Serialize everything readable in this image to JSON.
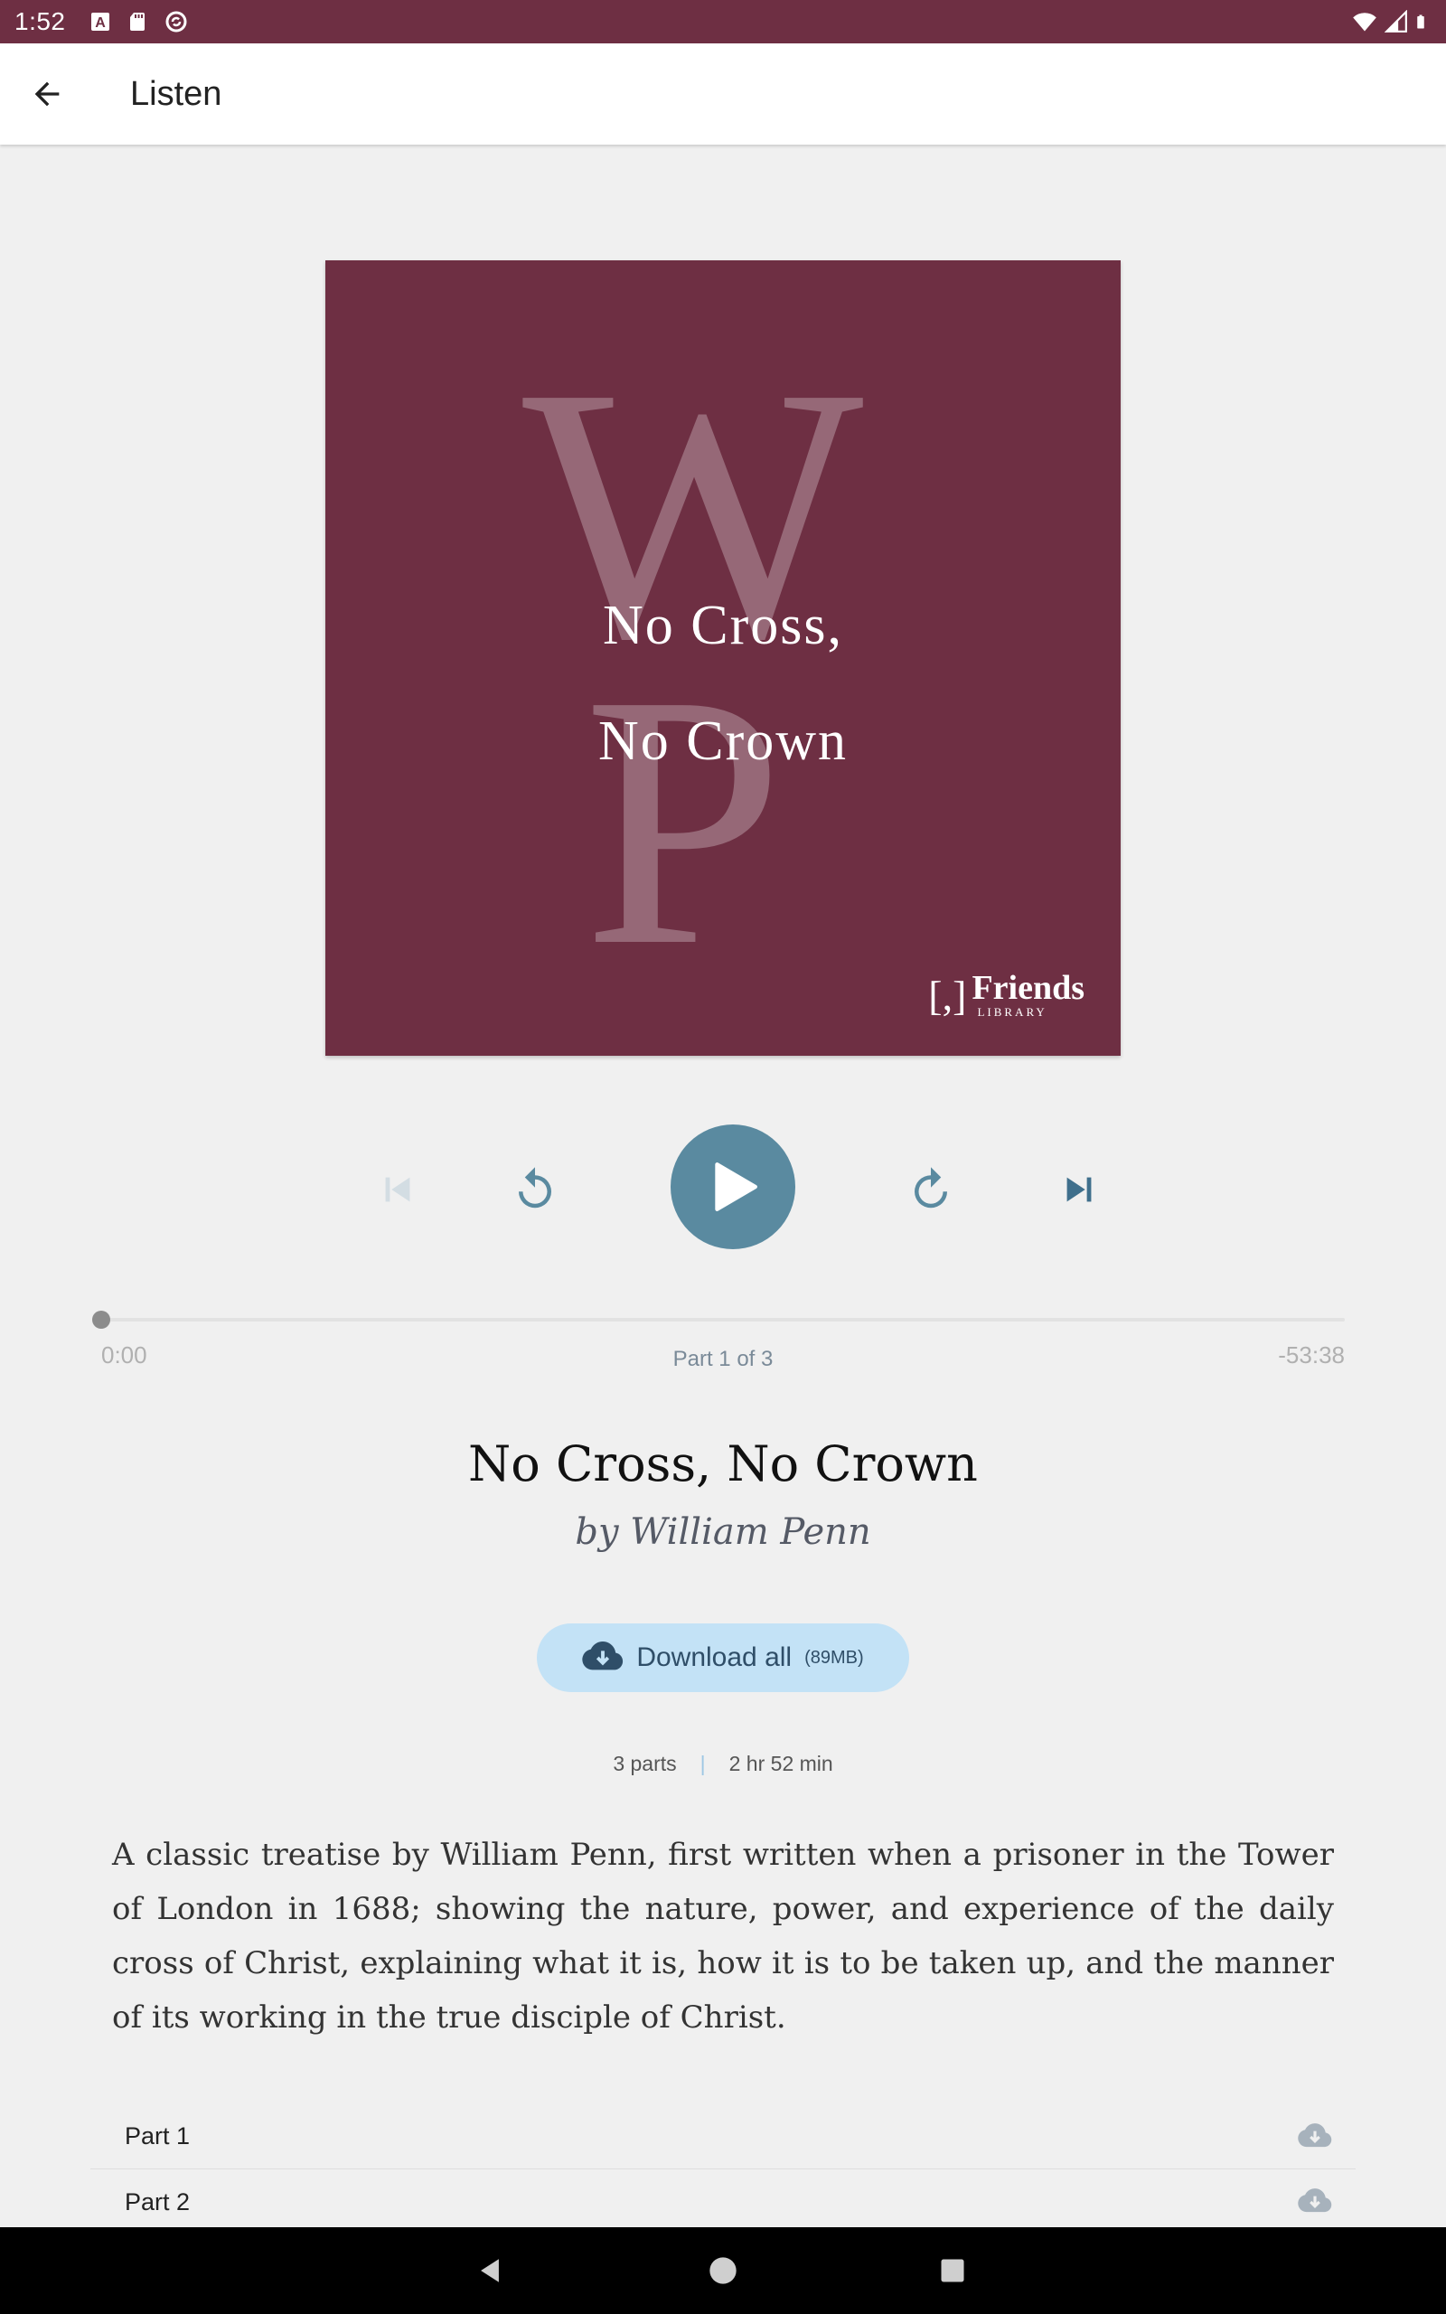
{
  "status_bar": {
    "time": "1:52",
    "left_icons": [
      "a-icon",
      "sd-card-icon",
      "sync-icon"
    ],
    "right_icons": [
      "wifi-icon",
      "signal-icon",
      "battery-icon"
    ]
  },
  "app_bar": {
    "title": "Listen"
  },
  "cover": {
    "title_line1": "No Cross,",
    "title_line2": "No Crown",
    "initials": [
      "W",
      "P"
    ],
    "logo_mark": "[,]",
    "logo_name": "Friends",
    "logo_sub": "LIBRARY",
    "bg_color": "#6e2f43"
  },
  "player": {
    "progress": 0,
    "time_elapsed": "0:00",
    "time_remaining": "-53:38",
    "part_indicator": "Part 1 of 3",
    "accent_color": "#5a8aa0"
  },
  "book": {
    "title": "No Cross, No Crown",
    "author": "by William Penn"
  },
  "download": {
    "label": "Download all",
    "size": "(89MB)"
  },
  "meta": {
    "parts": "3 parts",
    "duration": "2 hr 52 min"
  },
  "description": "A classic treatise by William Penn, first written when a prisoner in the Tower of London in 1688; showing the nature, power, and experience of the daily cross of Christ, explaining what it is, how it is to be taken up, and the manner of its working in the true disciple of Christ.",
  "parts_list": [
    {
      "label": "Part 1"
    },
    {
      "label": "Part 2"
    }
  ]
}
